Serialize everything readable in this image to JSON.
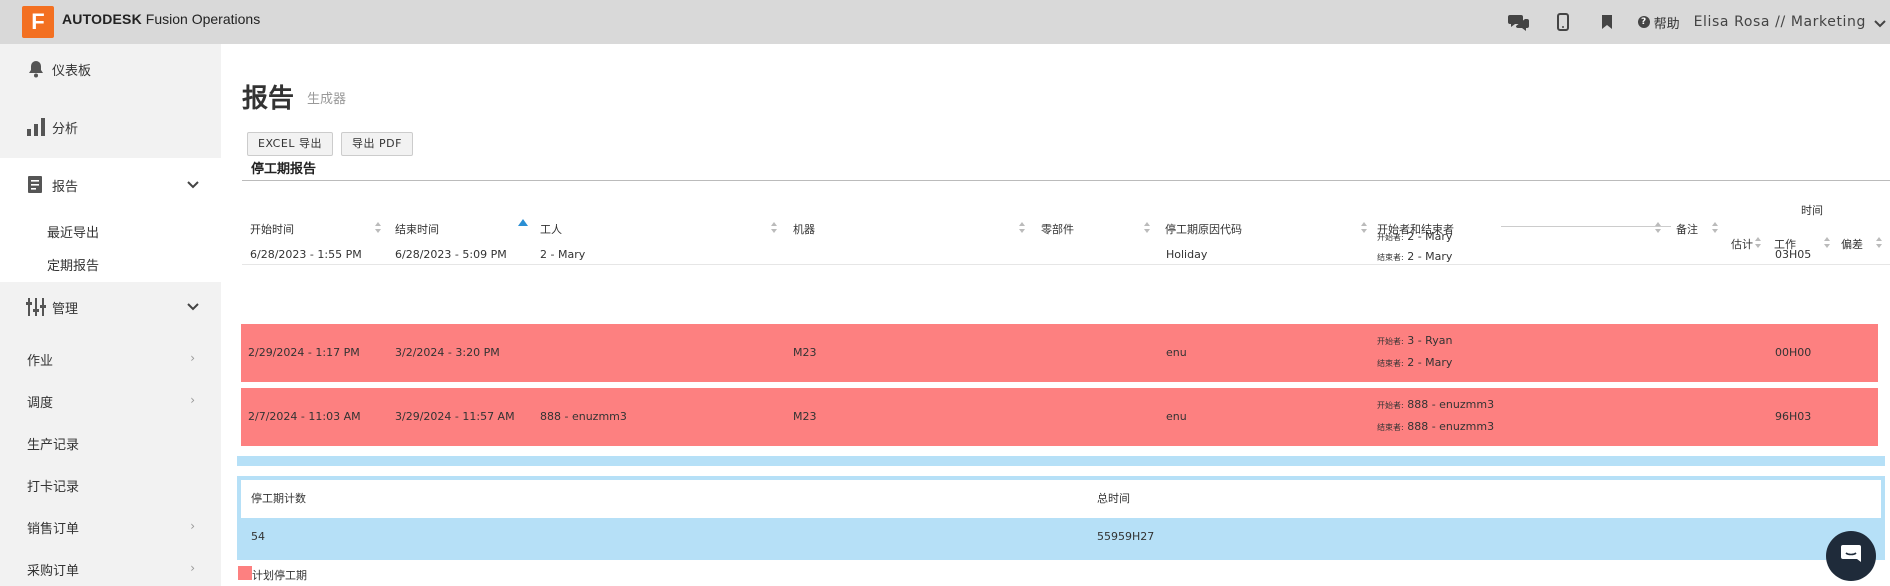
{
  "app": {
    "logo_letter": "F",
    "brand_bold": "AUTODESK",
    "brand_rest": "Fusion Operations",
    "brand_color": "#f37021"
  },
  "topbar": {
    "help_label": "帮助",
    "user_label": "Elisa Rosa // Marketing",
    "icons": [
      "chat-icon",
      "mobile-icon",
      "bookmark-icon",
      "help-icon",
      "chevron-down-icon"
    ]
  },
  "sidebar": {
    "items": [
      {
        "label": "仪表板",
        "icon": "bell-icon"
      },
      {
        "label": "分析",
        "icon": "bar-chart-icon"
      },
      {
        "label": "报告",
        "icon": "report-icon"
      },
      {
        "label": "管理",
        "icon": "sliders-icon"
      }
    ],
    "report_sub": [
      "最近导出",
      "定期报告"
    ],
    "plain_items": [
      "作业",
      "调度",
      "生产记录",
      "打卡记录",
      "销售订单",
      "采购订单"
    ]
  },
  "page": {
    "title": "报告",
    "subtitle": "生成器",
    "export_excel": "EXCEL 导出",
    "export_pdf": "导出 PDF",
    "section_title": "停工期报告"
  },
  "table": {
    "headers": {
      "start": "开始时间",
      "end": "结束时间",
      "worker": "工人",
      "machine": "机器",
      "part": "零部件",
      "reason": "停工期原因代码",
      "actors": "开始者和结束者",
      "notes": "备注",
      "time_group": "时间",
      "estimate": "估计",
      "work": "工作",
      "deviation": "偏差"
    },
    "starter_label": "开始者:",
    "ender_label": "结束者:",
    "rows": [
      {
        "start": "6/28/2023 - 1:55 PM",
        "end": "6/28/2023 - 5:09 PM",
        "worker": "2 - Mary",
        "machine": "",
        "reason": "Holiday",
        "starter": "2 - Mary",
        "ender": "2 - Mary",
        "work": "03H05",
        "planned": false
      },
      {
        "start": "2/29/2024 - 1:17 PM",
        "end": "3/2/2024 - 3:20 PM",
        "worker": "",
        "machine": "M23",
        "reason": "enu",
        "starter": "3 - Ryan",
        "ender": "2 - Mary",
        "work": "00H00",
        "planned": true
      },
      {
        "start": "2/7/2024 - 11:03 AM",
        "end": "3/29/2024 - 11:57 AM",
        "worker": "888 - enuzmm3",
        "machine": "M23",
        "reason": "enu",
        "starter": "888 - enuzmm3",
        "ender": "888 - enuzmm3",
        "work": "96H03",
        "planned": true
      }
    ]
  },
  "summary": {
    "count_label": "停工期计数",
    "total_label": "总时间",
    "count_value": "54",
    "total_value": "55959H27"
  },
  "legend": {
    "label": "计划停工期",
    "color": "#fd8080"
  }
}
